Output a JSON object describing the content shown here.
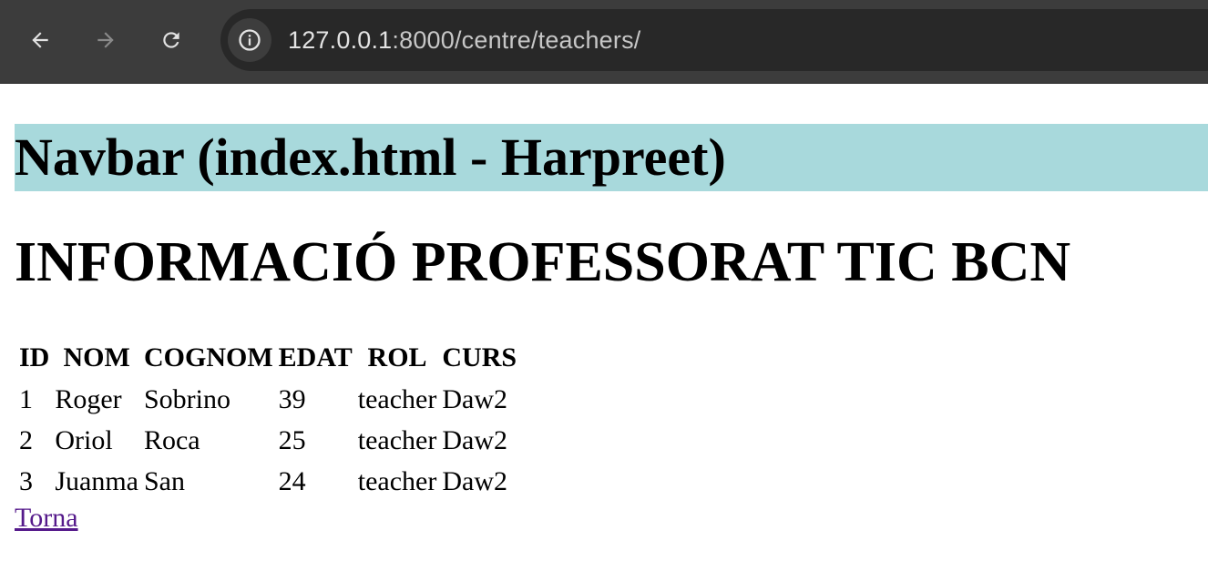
{
  "browser": {
    "url_host": "127.0.0.1",
    "url_path": ":8000/centre/teachers/",
    "icons": [
      "back-arrow-icon",
      "forward-arrow-icon",
      "reload-icon",
      "info-icon"
    ]
  },
  "navbar": {
    "text": "Navbar (index.html - Harpreet)",
    "background": "#a8d9dc"
  },
  "page": {
    "title": "INFORMACIÓ PROFESSORAT TIC BCN"
  },
  "table": {
    "headers": [
      "ID",
      "NOM",
      "COGNOM",
      "EDAT",
      "ROL",
      "CURS"
    ],
    "rows": [
      [
        "1",
        "Roger",
        "Sobrino",
        "39",
        "teacher",
        "Daw2"
      ],
      [
        "2",
        "Oriol",
        "Roca",
        "25",
        "teacher",
        "Daw2"
      ],
      [
        "3",
        "Juanma",
        "San",
        "24",
        "teacher",
        "Daw2"
      ]
    ]
  },
  "back_link": {
    "label": "Torna",
    "color": "#551a8b"
  }
}
